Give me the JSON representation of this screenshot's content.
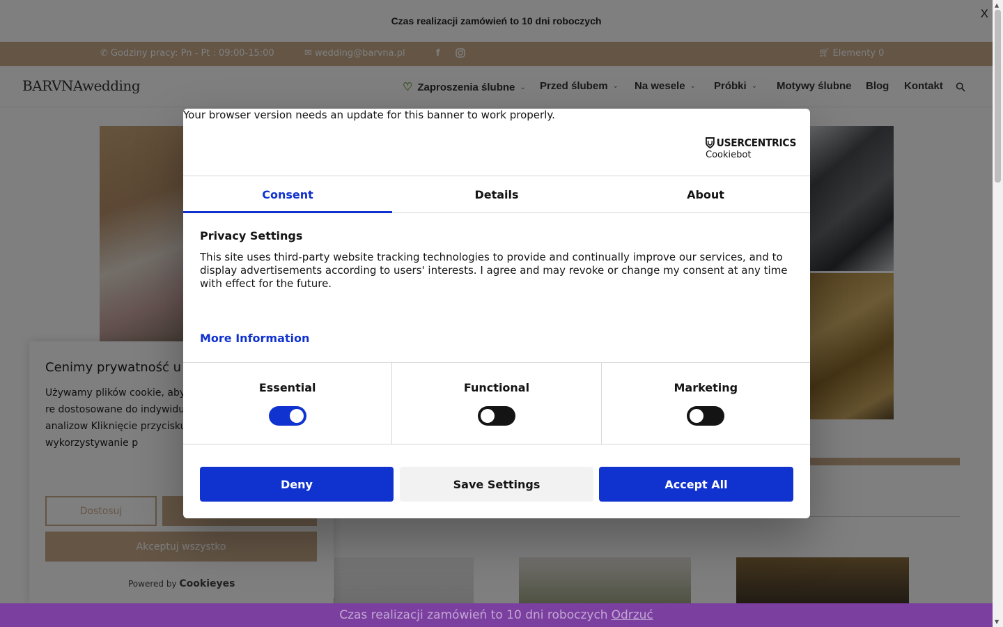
{
  "notice_bar": {
    "text": "Czas realizacji zamówień to 10 dni roboczych",
    "close_label": "X"
  },
  "top_bar": {
    "hours": "Godziny pracy: Pn - Pt : 09:00-15:00",
    "email": "wedding@barvna.pl",
    "cart": "Elementy 0"
  },
  "header": {
    "logo": "BARVNAwedding",
    "nav": [
      {
        "label": "Zaproszenia ślubne",
        "has_dropdown": true,
        "icon": "heart-icon"
      },
      {
        "label": "Przed ślubem",
        "has_dropdown": true
      },
      {
        "label": "Na wesele",
        "has_dropdown": true
      },
      {
        "label": "Próbki",
        "has_dropdown": true
      },
      {
        "label": "Motywy ślubne",
        "has_dropdown": false
      },
      {
        "label": "Blog",
        "has_dropdown": false
      },
      {
        "label": "Kontakt",
        "has_dropdown": false
      }
    ]
  },
  "cookieyes": {
    "title": "Cenimy prywatność u",
    "text": "Używamy plików cookie, aby przeglądania, wyświetlać re dostosowane do indywidua użytkowników oraz analizow Kliknięcie przycisku „Akcept zgodę na wykorzystywanie p",
    "customize_label": "Dostosuj",
    "accept_label": "Akceptuj wszystko",
    "powered_by": "Powered by",
    "brand": "Cookieyes"
  },
  "cookiebot": {
    "warning": "Your browser version needs an update for this banner to work properly.",
    "logo_top": "USERCENTRICS",
    "logo_bottom": "Cookiebot",
    "tabs": [
      {
        "label": "Consent",
        "active": true
      },
      {
        "label": "Details",
        "active": false
      },
      {
        "label": "About",
        "active": false
      }
    ],
    "heading": "Privacy Settings",
    "body": "This site uses third-party website tracking technologies to provide and continually improve our services, and to display advertisements according to users' interests. I agree and may revoke or change my consent at any time with effect for the future.",
    "more_info": "More Information",
    "categories": [
      {
        "label": "Essential",
        "on": true
      },
      {
        "label": "Functional",
        "on": false
      },
      {
        "label": "Marketing",
        "on": false
      }
    ],
    "buttons": {
      "deny": "Deny",
      "save": "Save Settings",
      "accept": "Accept All"
    },
    "colors": {
      "accent": "#1032cf",
      "toggle_off": "#141414"
    }
  },
  "bottom_bar": {
    "text": "Czas realizacji zamówień to 10 dni roboczych",
    "dismiss": "Odrzuć",
    "color": "#7b3fa0"
  },
  "colors": {
    "brand_beige": "#c9ab8a"
  }
}
